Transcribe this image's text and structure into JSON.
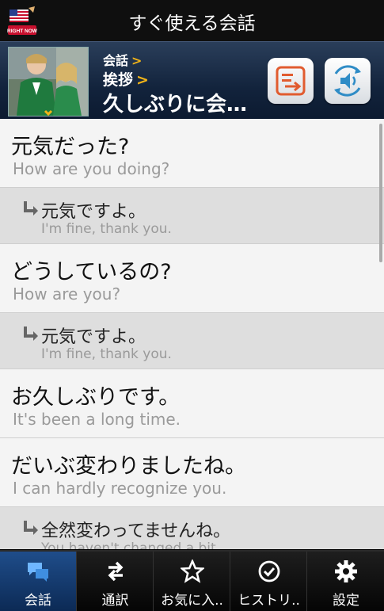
{
  "app": {
    "title": "すぐ使える会話",
    "icon_text": "RIGHT NOW"
  },
  "header": {
    "breadcrumb": [
      {
        "label": "会話",
        "chevron": ">"
      },
      {
        "label": "挨拶",
        "chevron": ">"
      }
    ],
    "current": "久しぶりに会…",
    "buttons": [
      {
        "name": "export-button",
        "icon": "export-icon",
        "color": "#e15b2f"
      },
      {
        "name": "audio-button",
        "icon": "speaker-refresh-icon",
        "color": "#2f8cc6"
      }
    ]
  },
  "phrases": [
    {
      "type": "q",
      "jp": "元気だった?",
      "en": "How are you doing?"
    },
    {
      "type": "a",
      "jp": "元気ですよ。",
      "en": "I'm fine, thank you."
    },
    {
      "type": "q",
      "jp": "どうしているの?",
      "en": "How are you?"
    },
    {
      "type": "a",
      "jp": "元気ですよ。",
      "en": "I'm fine, thank you."
    },
    {
      "type": "q",
      "jp": "お久しぶりです。",
      "en": "It's been a long time."
    },
    {
      "type": "q",
      "jp": "だいぶ変わりましたね。",
      "en": "I can hardly recognize you."
    },
    {
      "type": "a",
      "jp": "全然変わってませんね。",
      "en": "You haven't changed a bit."
    }
  ],
  "tabs": [
    {
      "label": "会話",
      "icon": "chat-icon",
      "active": true
    },
    {
      "label": "通訳",
      "icon": "swap-arrows-icon",
      "active": false
    },
    {
      "label": "お気に入..",
      "icon": "star-icon",
      "active": false
    },
    {
      "label": "ヒストリ..",
      "icon": "check-circle-icon",
      "active": false
    },
    {
      "label": "設定",
      "icon": "gear-icon",
      "active": false
    }
  ],
  "colors": {
    "accent": "#f2b418",
    "active_tab": "#1f4d8a"
  }
}
